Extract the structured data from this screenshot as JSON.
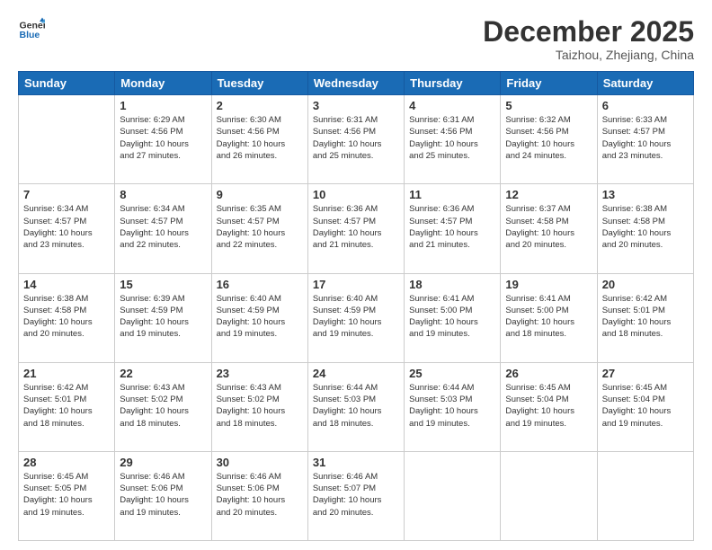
{
  "header": {
    "logo_line1": "General",
    "logo_line2": "Blue",
    "month": "December 2025",
    "location": "Taizhou, Zhejiang, China"
  },
  "weekdays": [
    "Sunday",
    "Monday",
    "Tuesday",
    "Wednesday",
    "Thursday",
    "Friday",
    "Saturday"
  ],
  "weeks": [
    [
      {
        "day": "",
        "info": ""
      },
      {
        "day": "1",
        "info": "Sunrise: 6:29 AM\nSunset: 4:56 PM\nDaylight: 10 hours\nand 27 minutes."
      },
      {
        "day": "2",
        "info": "Sunrise: 6:30 AM\nSunset: 4:56 PM\nDaylight: 10 hours\nand 26 minutes."
      },
      {
        "day": "3",
        "info": "Sunrise: 6:31 AM\nSunset: 4:56 PM\nDaylight: 10 hours\nand 25 minutes."
      },
      {
        "day": "4",
        "info": "Sunrise: 6:31 AM\nSunset: 4:56 PM\nDaylight: 10 hours\nand 25 minutes."
      },
      {
        "day": "5",
        "info": "Sunrise: 6:32 AM\nSunset: 4:56 PM\nDaylight: 10 hours\nand 24 minutes."
      },
      {
        "day": "6",
        "info": "Sunrise: 6:33 AM\nSunset: 4:57 PM\nDaylight: 10 hours\nand 23 minutes."
      }
    ],
    [
      {
        "day": "7",
        "info": "Sunrise: 6:34 AM\nSunset: 4:57 PM\nDaylight: 10 hours\nand 23 minutes."
      },
      {
        "day": "8",
        "info": "Sunrise: 6:34 AM\nSunset: 4:57 PM\nDaylight: 10 hours\nand 22 minutes."
      },
      {
        "day": "9",
        "info": "Sunrise: 6:35 AM\nSunset: 4:57 PM\nDaylight: 10 hours\nand 22 minutes."
      },
      {
        "day": "10",
        "info": "Sunrise: 6:36 AM\nSunset: 4:57 PM\nDaylight: 10 hours\nand 21 minutes."
      },
      {
        "day": "11",
        "info": "Sunrise: 6:36 AM\nSunset: 4:57 PM\nDaylight: 10 hours\nand 21 minutes."
      },
      {
        "day": "12",
        "info": "Sunrise: 6:37 AM\nSunset: 4:58 PM\nDaylight: 10 hours\nand 20 minutes."
      },
      {
        "day": "13",
        "info": "Sunrise: 6:38 AM\nSunset: 4:58 PM\nDaylight: 10 hours\nand 20 minutes."
      }
    ],
    [
      {
        "day": "14",
        "info": "Sunrise: 6:38 AM\nSunset: 4:58 PM\nDaylight: 10 hours\nand 20 minutes."
      },
      {
        "day": "15",
        "info": "Sunrise: 6:39 AM\nSunset: 4:59 PM\nDaylight: 10 hours\nand 19 minutes."
      },
      {
        "day": "16",
        "info": "Sunrise: 6:40 AM\nSunset: 4:59 PM\nDaylight: 10 hours\nand 19 minutes."
      },
      {
        "day": "17",
        "info": "Sunrise: 6:40 AM\nSunset: 4:59 PM\nDaylight: 10 hours\nand 19 minutes."
      },
      {
        "day": "18",
        "info": "Sunrise: 6:41 AM\nSunset: 5:00 PM\nDaylight: 10 hours\nand 19 minutes."
      },
      {
        "day": "19",
        "info": "Sunrise: 6:41 AM\nSunset: 5:00 PM\nDaylight: 10 hours\nand 18 minutes."
      },
      {
        "day": "20",
        "info": "Sunrise: 6:42 AM\nSunset: 5:01 PM\nDaylight: 10 hours\nand 18 minutes."
      }
    ],
    [
      {
        "day": "21",
        "info": "Sunrise: 6:42 AM\nSunset: 5:01 PM\nDaylight: 10 hours\nand 18 minutes."
      },
      {
        "day": "22",
        "info": "Sunrise: 6:43 AM\nSunset: 5:02 PM\nDaylight: 10 hours\nand 18 minutes."
      },
      {
        "day": "23",
        "info": "Sunrise: 6:43 AM\nSunset: 5:02 PM\nDaylight: 10 hours\nand 18 minutes."
      },
      {
        "day": "24",
        "info": "Sunrise: 6:44 AM\nSunset: 5:03 PM\nDaylight: 10 hours\nand 18 minutes."
      },
      {
        "day": "25",
        "info": "Sunrise: 6:44 AM\nSunset: 5:03 PM\nDaylight: 10 hours\nand 19 minutes."
      },
      {
        "day": "26",
        "info": "Sunrise: 6:45 AM\nSunset: 5:04 PM\nDaylight: 10 hours\nand 19 minutes."
      },
      {
        "day": "27",
        "info": "Sunrise: 6:45 AM\nSunset: 5:04 PM\nDaylight: 10 hours\nand 19 minutes."
      }
    ],
    [
      {
        "day": "28",
        "info": "Sunrise: 6:45 AM\nSunset: 5:05 PM\nDaylight: 10 hours\nand 19 minutes."
      },
      {
        "day": "29",
        "info": "Sunrise: 6:46 AM\nSunset: 5:06 PM\nDaylight: 10 hours\nand 19 minutes."
      },
      {
        "day": "30",
        "info": "Sunrise: 6:46 AM\nSunset: 5:06 PM\nDaylight: 10 hours\nand 20 minutes."
      },
      {
        "day": "31",
        "info": "Sunrise: 6:46 AM\nSunset: 5:07 PM\nDaylight: 10 hours\nand 20 minutes."
      },
      {
        "day": "",
        "info": ""
      },
      {
        "day": "",
        "info": ""
      },
      {
        "day": "",
        "info": ""
      }
    ]
  ]
}
